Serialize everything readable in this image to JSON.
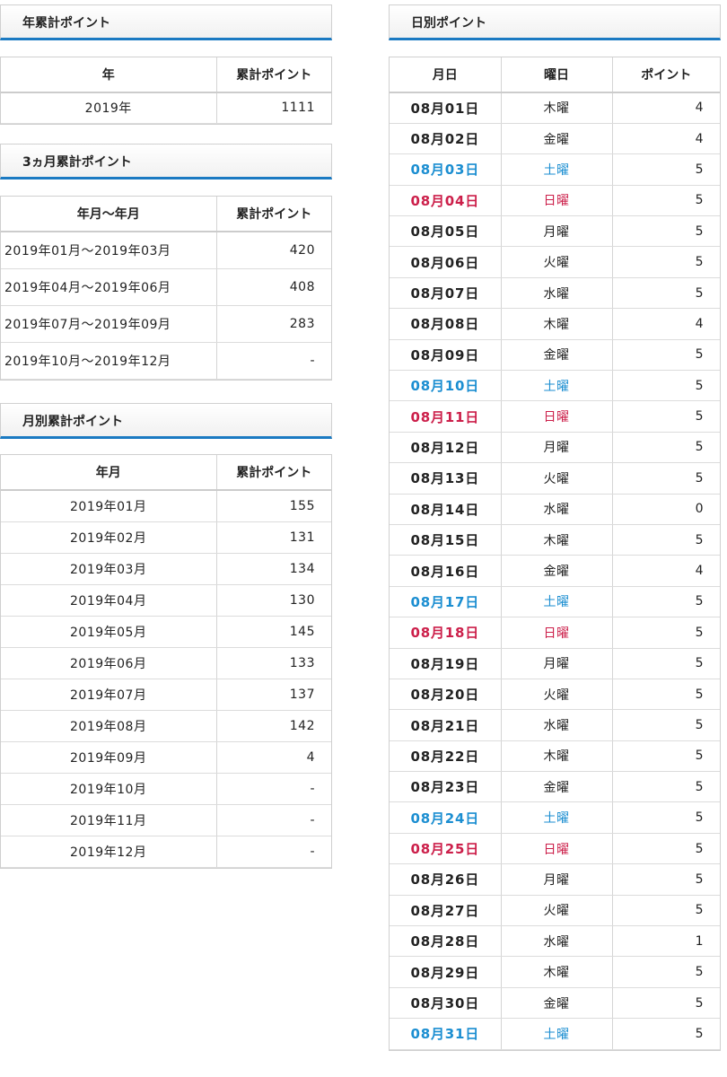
{
  "annual": {
    "title": "年累計ポイント",
    "headers": [
      "年",
      "累計ポイント"
    ],
    "rows": [
      [
        "2019年",
        "1111"
      ]
    ]
  },
  "quarterly": {
    "title": "3ヵ月累計ポイント",
    "headers": [
      "年月～年月",
      "累計ポイント"
    ],
    "rows": [
      [
        "2019年01月～2019年03月",
        "420"
      ],
      [
        "2019年04月～2019年06月",
        "408"
      ],
      [
        "2019年07月～2019年09月",
        "283"
      ],
      [
        "2019年10月～2019年12月",
        "-"
      ]
    ]
  },
  "monthly": {
    "title": "月別累計ポイント",
    "headers": [
      "年月",
      "累計ポイント"
    ],
    "rows": [
      [
        "2019年01月",
        "155"
      ],
      [
        "2019年02月",
        "131"
      ],
      [
        "2019年03月",
        "134"
      ],
      [
        "2019年04月",
        "130"
      ],
      [
        "2019年05月",
        "145"
      ],
      [
        "2019年06月",
        "133"
      ],
      [
        "2019年07月",
        "137"
      ],
      [
        "2019年08月",
        "142"
      ],
      [
        "2019年09月",
        "4"
      ],
      [
        "2019年10月",
        "-"
      ],
      [
        "2019年11月",
        "-"
      ],
      [
        "2019年12月",
        "-"
      ]
    ]
  },
  "daily": {
    "title": "日別ポイント",
    "headers": [
      "月日",
      "曜日",
      "ポイント"
    ],
    "colors": {
      "saturday": "#1b8ed1",
      "sunday": "#cc1f4a",
      "accent": "#1b7ac2"
    },
    "rows": [
      [
        "08月01日",
        "木曜",
        "4"
      ],
      [
        "08月02日",
        "金曜",
        "4"
      ],
      [
        "08月03日",
        "土曜",
        "5"
      ],
      [
        "08月04日",
        "日曜",
        "5"
      ],
      [
        "08月05日",
        "月曜",
        "5"
      ],
      [
        "08月06日",
        "火曜",
        "5"
      ],
      [
        "08月07日",
        "水曜",
        "5"
      ],
      [
        "08月08日",
        "木曜",
        "4"
      ],
      [
        "08月09日",
        "金曜",
        "5"
      ],
      [
        "08月10日",
        "土曜",
        "5"
      ],
      [
        "08月11日",
        "日曜",
        "5"
      ],
      [
        "08月12日",
        "月曜",
        "5"
      ],
      [
        "08月13日",
        "火曜",
        "5"
      ],
      [
        "08月14日",
        "水曜",
        "0"
      ],
      [
        "08月15日",
        "木曜",
        "5"
      ],
      [
        "08月16日",
        "金曜",
        "4"
      ],
      [
        "08月17日",
        "土曜",
        "5"
      ],
      [
        "08月18日",
        "日曜",
        "5"
      ],
      [
        "08月19日",
        "月曜",
        "5"
      ],
      [
        "08月20日",
        "火曜",
        "5"
      ],
      [
        "08月21日",
        "水曜",
        "5"
      ],
      [
        "08月22日",
        "木曜",
        "5"
      ],
      [
        "08月23日",
        "金曜",
        "5"
      ],
      [
        "08月24日",
        "土曜",
        "5"
      ],
      [
        "08月25日",
        "日曜",
        "5"
      ],
      [
        "08月26日",
        "月曜",
        "5"
      ],
      [
        "08月27日",
        "火曜",
        "5"
      ],
      [
        "08月28日",
        "水曜",
        "1"
      ],
      [
        "08月29日",
        "木曜",
        "5"
      ],
      [
        "08月30日",
        "金曜",
        "5"
      ],
      [
        "08月31日",
        "土曜",
        "5"
      ]
    ]
  }
}
